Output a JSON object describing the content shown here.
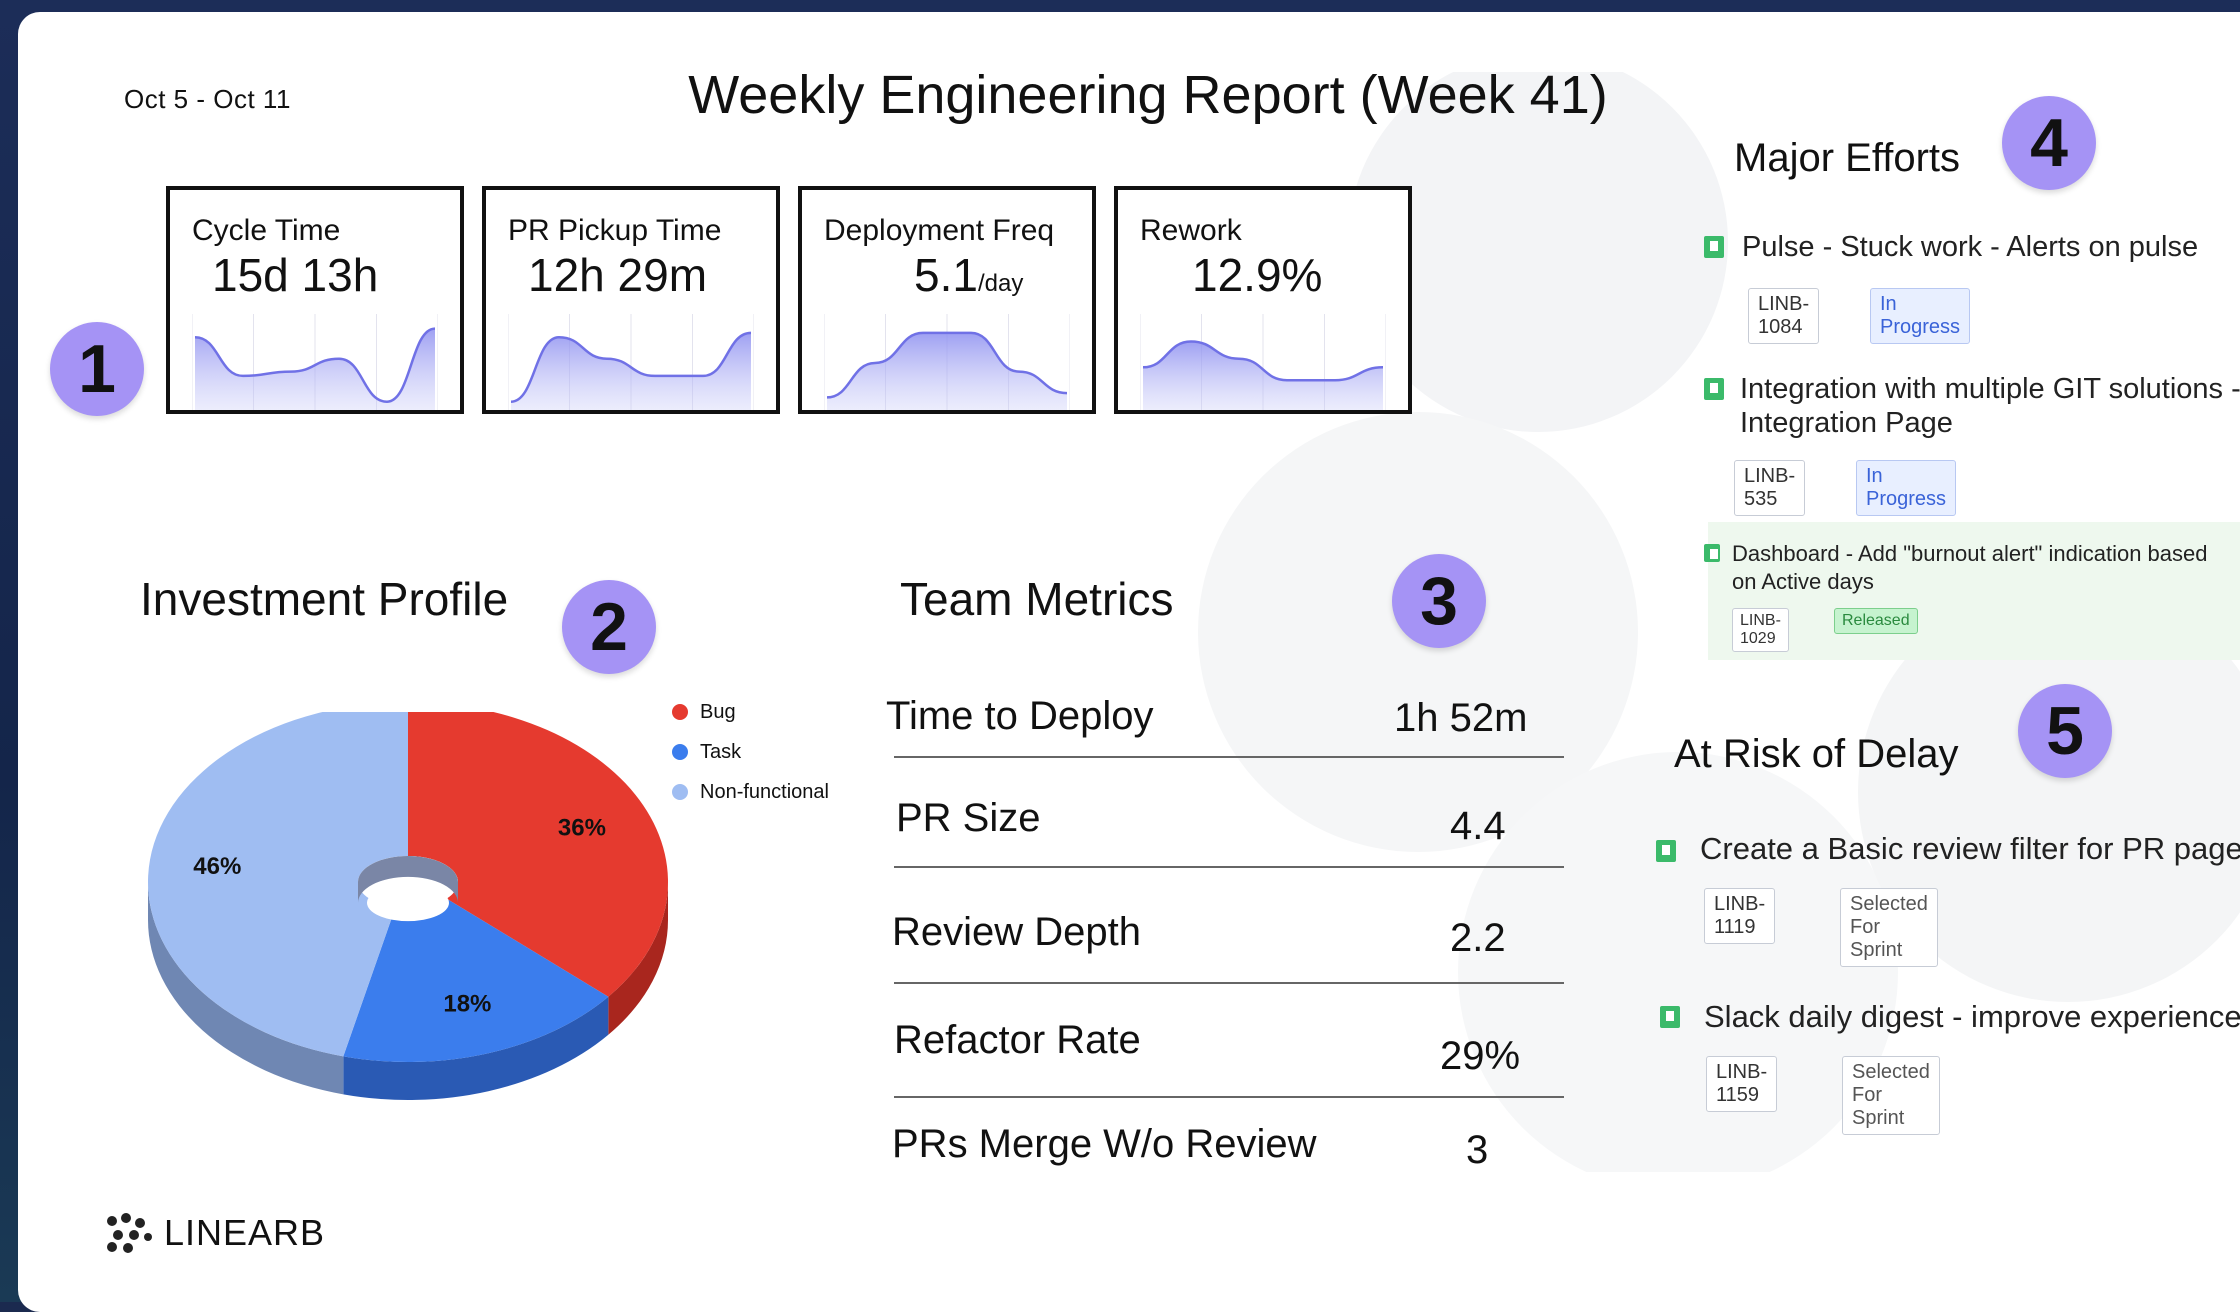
{
  "header": {
    "date_range": "Oct 5 - Oct 11",
    "title": "Weekly Engineering Report (Week 41)"
  },
  "badges": [
    "1",
    "2",
    "3",
    "4",
    "5"
  ],
  "kpis": [
    {
      "label": "Cycle Time",
      "value": "15d 13h",
      "unit": "",
      "trend": [
        0.8,
        0.35,
        0.4,
        0.55,
        0.05,
        0.9
      ]
    },
    {
      "label": "PR Pickup Time",
      "value": "12h 29m",
      "unit": "",
      "trend": [
        0.05,
        0.8,
        0.55,
        0.35,
        0.35,
        0.85
      ]
    },
    {
      "label": "Deployment Freq",
      "value": "5.1",
      "unit": "/day",
      "trend": [
        0.1,
        0.5,
        0.85,
        0.85,
        0.4,
        0.15
      ]
    },
    {
      "label": "Rework",
      "value": "12.9%",
      "unit": "",
      "trend": [
        0.45,
        0.75,
        0.55,
        0.3,
        0.3,
        0.45
      ]
    }
  ],
  "investment": {
    "title": "Investment Profile"
  },
  "chart_data": {
    "type": "pie",
    "categories": [
      "Bug",
      "Task",
      "Non-functional"
    ],
    "values": [
      36,
      18,
      46
    ],
    "labels": [
      "36%",
      "18%",
      "46%"
    ],
    "colors": [
      "#e53a2f",
      "#3b7ded",
      "#9fbdf2"
    ],
    "legend": "right"
  },
  "team_metrics": {
    "title": "Team Metrics",
    "rows": [
      {
        "name": "Time to Deploy",
        "value": "1h 52m"
      },
      {
        "name": "PR Size",
        "value": "4.4"
      },
      {
        "name": "Review Depth",
        "value": "2.2"
      },
      {
        "name": "Refactor Rate",
        "value": "29%"
      },
      {
        "name": "PRs Merge W/o Review",
        "value": "3"
      }
    ]
  },
  "major_efforts": {
    "title": "Major Efforts",
    "items": [
      {
        "line1": "Pulse - Stuck work - Alerts on pulse",
        "line2": "",
        "key": "LINB-1084",
        "status": "In Progress"
      },
      {
        "line1": "Integration with multiple GIT solutions -",
        "line2": "Integration Page",
        "key": "LINB-535",
        "status": "In Progress"
      },
      {
        "line1": "Dashboard - Add \"burnout alert\" indication based",
        "line2": "on Active days",
        "key": "LINB-1029",
        "status": "Released"
      }
    ]
  },
  "at_risk": {
    "title": "At Risk of Delay",
    "items": [
      {
        "text": "Create a Basic review filter for PR page",
        "key": "LINB-1119",
        "status": "Selected For Sprint"
      },
      {
        "text": "Slack daily digest - improve experience",
        "key": "LINB-1159",
        "status": "Selected For Sprint"
      }
    ]
  },
  "logo": {
    "text": "LINEARB"
  }
}
